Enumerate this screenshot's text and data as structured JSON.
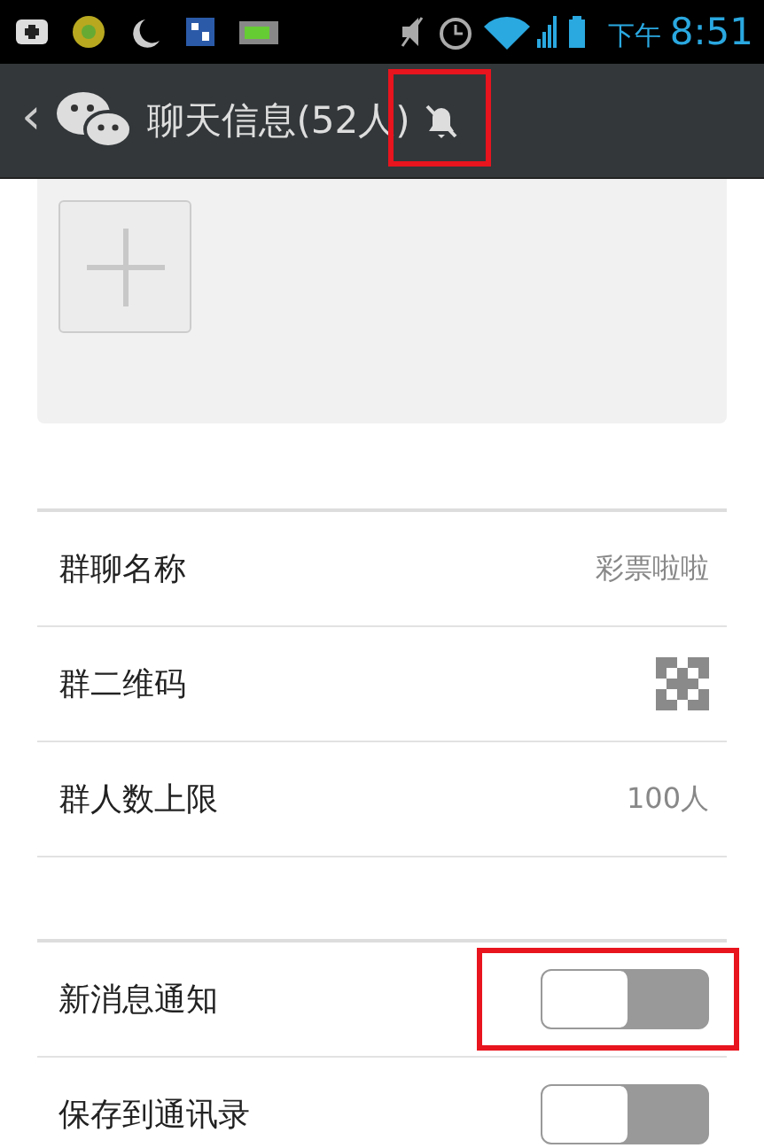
{
  "status_bar": {
    "time_prefix": "下午",
    "time": "8:51"
  },
  "header": {
    "back": "‹",
    "title": "聊天信息(52人)",
    "muted": true,
    "mute_highlighted": true
  },
  "info_rows": [
    {
      "kind": "text",
      "label": "群聊名称",
      "value": "彩票啦啦"
    },
    {
      "kind": "qr",
      "label": "群二维码"
    },
    {
      "kind": "text",
      "label": "群人数上限",
      "value": "100人"
    }
  ],
  "toggle_rows": [
    {
      "label": "新消息通知",
      "on": false,
      "highlighted": true
    },
    {
      "label": "保存到通讯录",
      "on": false
    }
  ]
}
